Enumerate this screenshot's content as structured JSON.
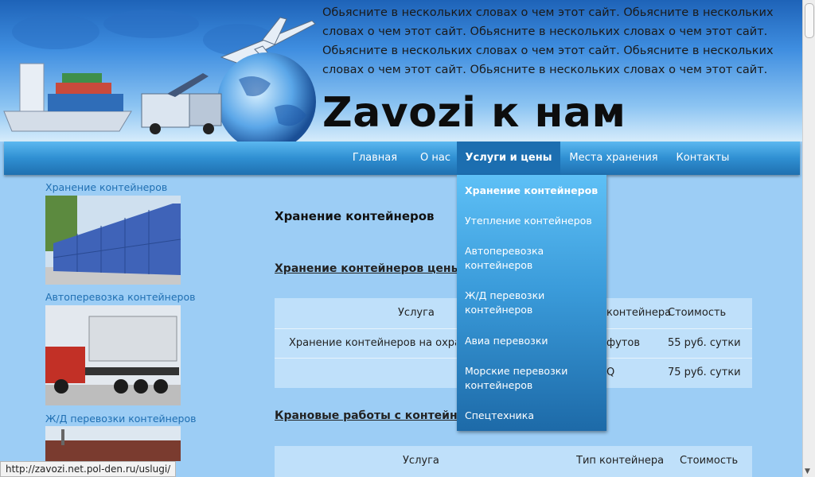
{
  "header": {
    "tagline": "Обьясните в нескольких словах о чем этот сайт. Обьясните в нескольких словах о чем этот сайт. Обьясните в нескольких словах о чем этот сайт. Обьясните в нескольких словах о чем этот сайт. Обьясните в нескольких словах о чем этот сайт. Обьясните в нескольких словах о чем этот сайт.",
    "site_title": "Zavozi к нам"
  },
  "nav": {
    "items": [
      {
        "label": "Главная"
      },
      {
        "label": "О нас"
      },
      {
        "label": "Услуги и цены"
      },
      {
        "label": "Места хранения"
      },
      {
        "label": "Контакты"
      }
    ]
  },
  "dropdown": {
    "items": [
      {
        "label": "Хранение контейнеров"
      },
      {
        "label": "Утепление контейнеров"
      },
      {
        "label": "Автоперевозка контейнеров"
      },
      {
        "label": "Ж/Д перевозки контейнеров"
      },
      {
        "label": "Авиа перевозки"
      },
      {
        "label": "Морские перевозки контейнеров"
      },
      {
        "label": "Спецтехника"
      }
    ]
  },
  "sidebar": {
    "items": [
      {
        "label": "Хранение контейнеров"
      },
      {
        "label": "Автоперевозка контейнеров"
      },
      {
        "label": "Ж/Д перевозки контейнеров"
      }
    ]
  },
  "main": {
    "title": "Хранение контейнеров",
    "table1": {
      "title": "Хранение контейнеров цены",
      "headers": [
        "Услуга",
        "контейнера",
        "Стоимость"
      ],
      "rows": [
        [
          "Хранение контейнеров на охрана",
          "футов",
          "55 руб. сутки"
        ],
        [
          "",
          "Q",
          "75 руб. сутки"
        ]
      ]
    },
    "table2": {
      "title": "Крановые работы с контейне",
      "headers": [
        "Услуга",
        "Тип контейнера",
        "Стоимость"
      ]
    }
  },
  "statusbar": {
    "url": "http://zavozi.net.pol-den.ru/uslugi/"
  },
  "colors": {
    "accent": "#2f8fd2",
    "link": "#1f6fb2",
    "background": "#9ccdf5"
  }
}
